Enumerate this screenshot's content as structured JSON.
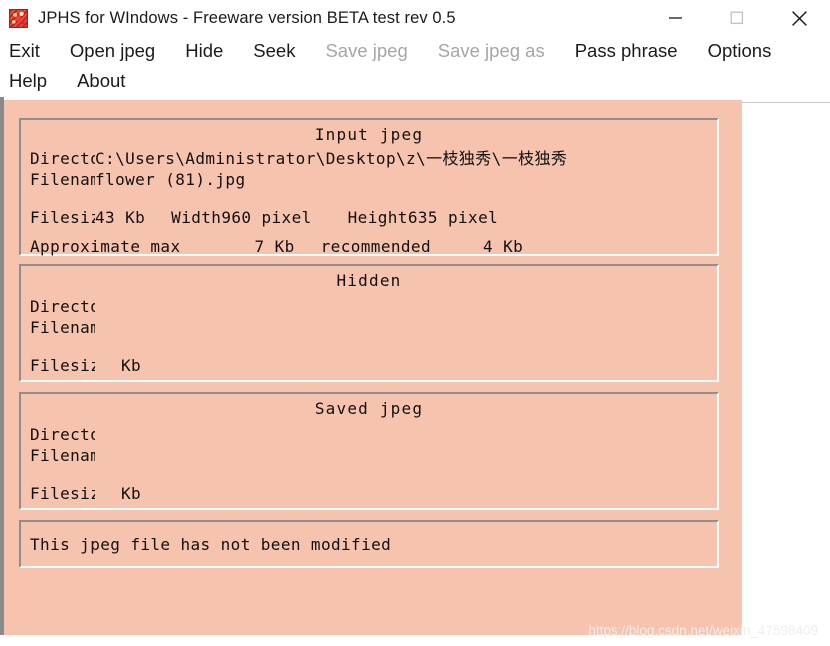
{
  "window": {
    "title": "JPHS for WIndows - Freeware version BETA test rev 0.5",
    "icon": "app-icon",
    "controls": {
      "minimize": "minimize-icon",
      "maximize": "maximize-icon",
      "close": "close-icon"
    }
  },
  "menu": {
    "row1": [
      {
        "label": "Exit",
        "enabled": true
      },
      {
        "label": "Open jpeg",
        "enabled": true
      },
      {
        "label": "Hide",
        "enabled": true
      },
      {
        "label": "Seek",
        "enabled": true
      },
      {
        "label": "Save jpeg",
        "enabled": false
      },
      {
        "label": "Save jpeg as",
        "enabled": false
      },
      {
        "label": "Pass phrase",
        "enabled": true
      },
      {
        "label": "Options",
        "enabled": true
      }
    ],
    "row2": [
      {
        "label": "Help",
        "enabled": true
      },
      {
        "label": "About",
        "enabled": true
      }
    ]
  },
  "input_panel": {
    "title": "Input  jpeg",
    "directory_label": "Directory",
    "directory_value": "C:\\Users\\Administrator\\Desktop\\z\\一枝独秀\\一枝独秀",
    "filename_label": "Filename",
    "filename_value": "flower (81).jpg",
    "filesize_label": "Filesize",
    "filesize_value": "43 Kb",
    "width_label": "Width",
    "width_value": "960 pixel",
    "height_label": "Height",
    "height_value": "635 pixel",
    "approx_label": "Approximate max",
    "approx_value": "7 Kb",
    "recommended_label": "recommended",
    "recommended_value": "4 Kb"
  },
  "hidden_panel": {
    "title": "Hidden",
    "directory_label": "Directory",
    "directory_value": "",
    "filename_label": "Filename",
    "filename_value": "",
    "filesize_label": "Filesize",
    "filesize_value": "",
    "filesize_unit": "Kb"
  },
  "saved_panel": {
    "title": "Saved  jpeg",
    "directory_label": "Directory",
    "directory_value": "",
    "filename_label": "Filename",
    "filename_value": "",
    "filesize_label": "Filesize",
    "filesize_value": "",
    "filesize_unit": "Kb"
  },
  "status": {
    "message": "This jpeg file has not been modified"
  },
  "watermark": {
    "text": "https://blog.csdn.net/weixin_47598409"
  },
  "colors": {
    "client_background": "#f6c3ae",
    "panel_background": "#f6c3ae",
    "panel_border_dark": "#8f8f8f",
    "panel_border_light": "#ffffff",
    "text": "#111111",
    "menu_disabled": "#a6a6a6",
    "watermark": "#eeeeee"
  }
}
